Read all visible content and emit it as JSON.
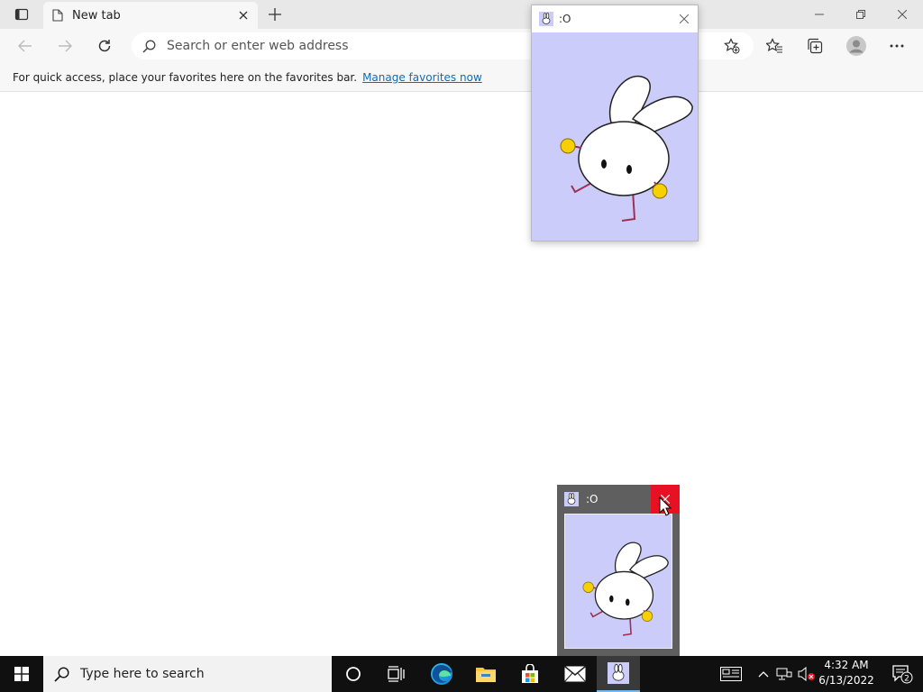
{
  "browser": {
    "tab_title": "New tab",
    "address_placeholder": "Search or enter web address",
    "favbar_text": "For quick access, place your favorites here on the favorites bar.",
    "favbar_link": "Manage favorites now"
  },
  "app_window": {
    "title": ":O"
  },
  "taskbar_preview": {
    "title": ":O"
  },
  "taskbar": {
    "search_placeholder": "Type here to search",
    "apps": [
      "cortana-icon",
      "task-view-icon",
      "edge-icon",
      "file-explorer-icon",
      "store-icon",
      "mail-icon",
      "bunny-app-icon"
    ],
    "active_app": "bunny-app-icon"
  },
  "clock": {
    "time": "4:32 AM",
    "date": "6/13/2022"
  },
  "notifications": {
    "count": "2"
  },
  "colors": {
    "accent": "#0f6cbd",
    "app_bg": "#ccccfa",
    "close_red": "#e81123",
    "taskbar": "#101010"
  }
}
